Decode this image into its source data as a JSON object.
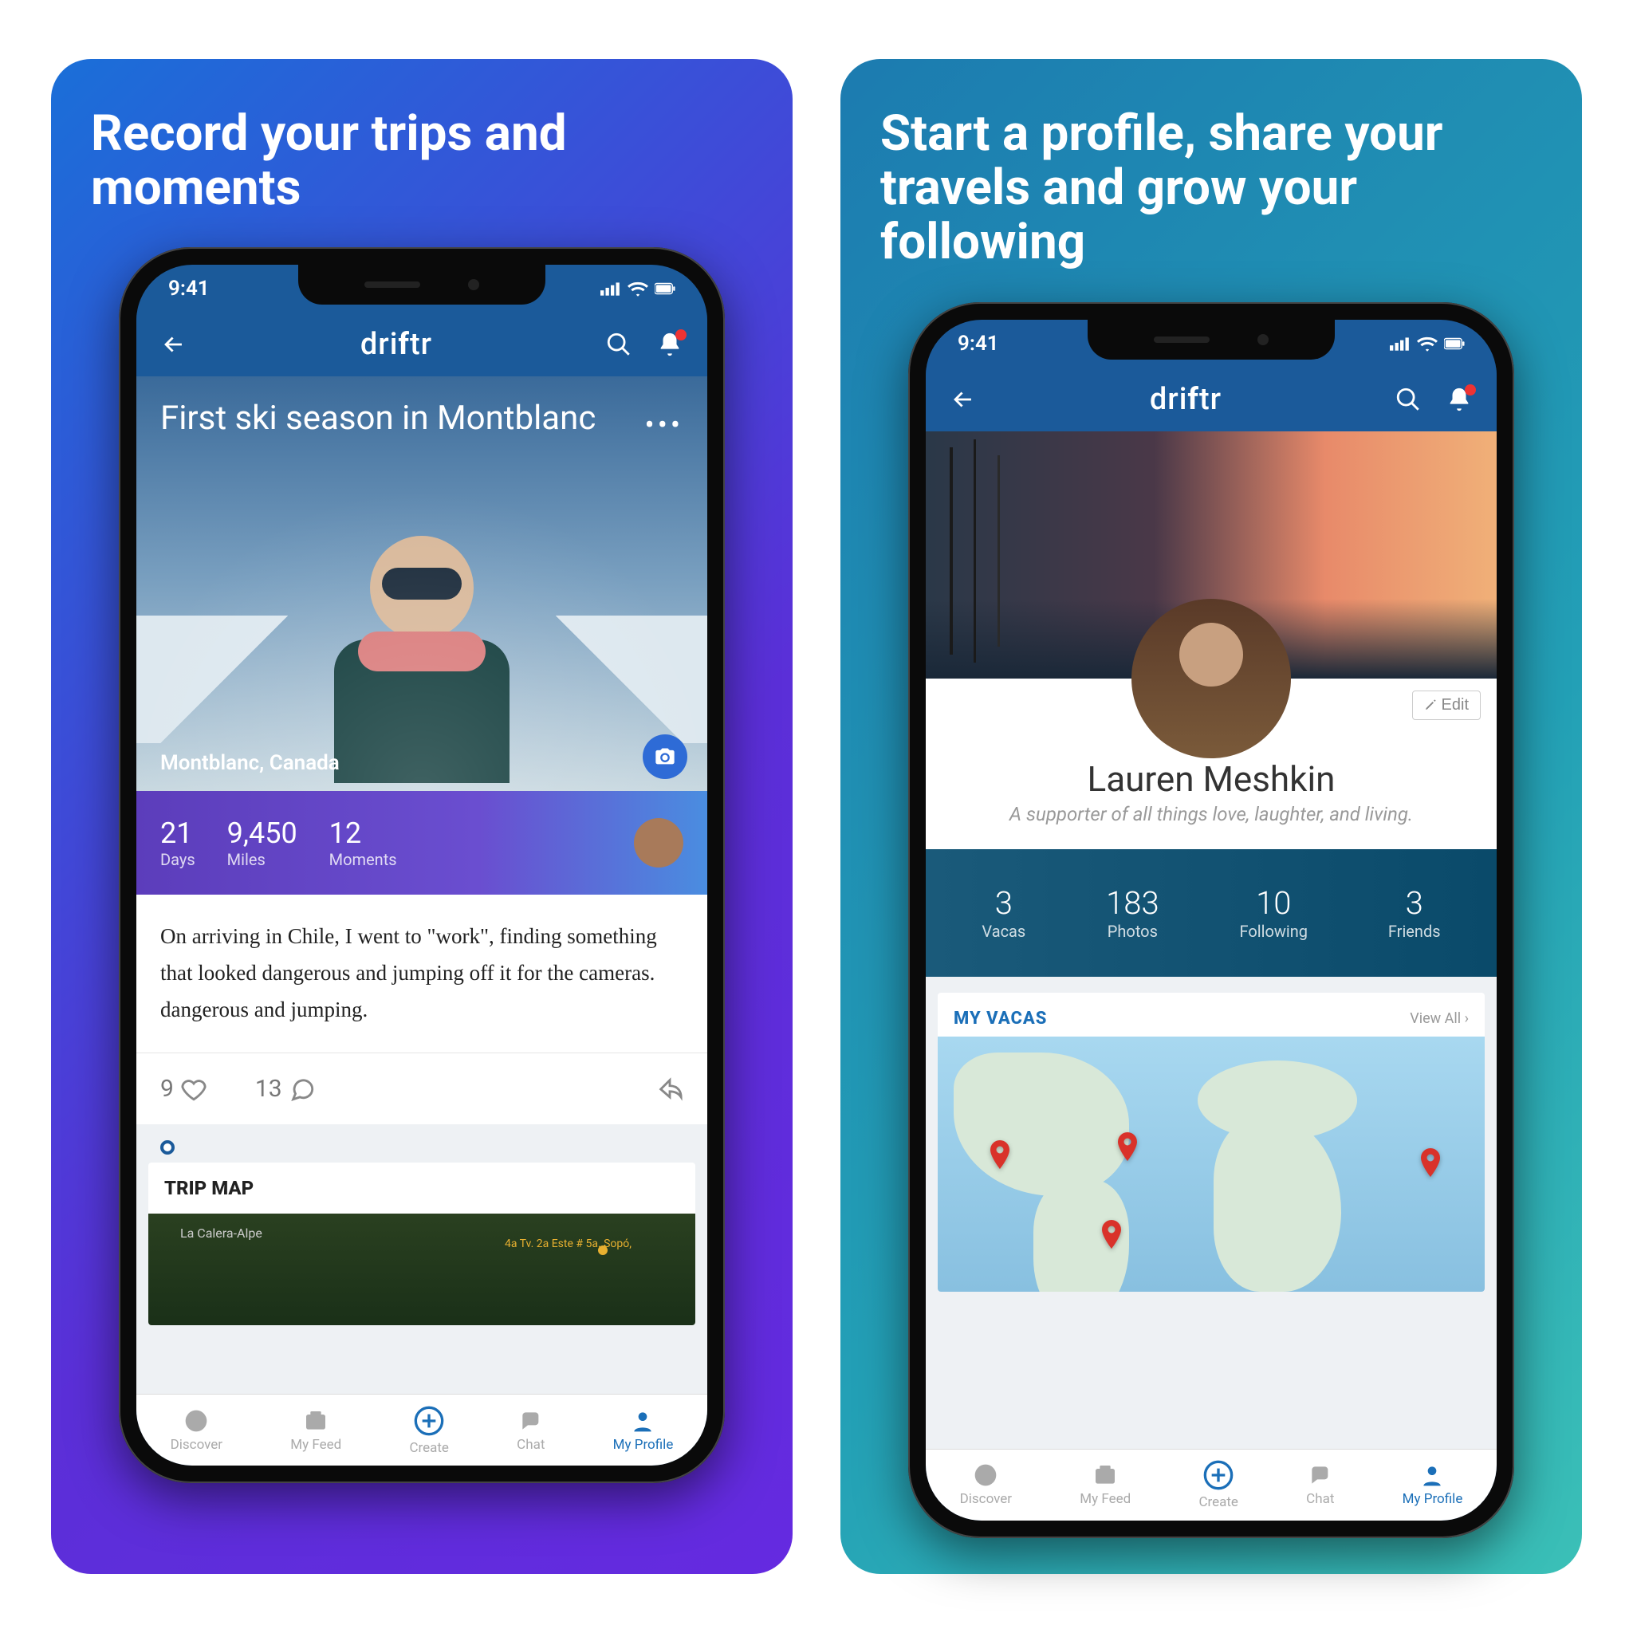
{
  "app": {
    "brand": "driftr",
    "statusTime": "9:41"
  },
  "nav": {
    "tabs": [
      {
        "label": "Discover"
      },
      {
        "label": "My Feed"
      },
      {
        "label": "Create"
      },
      {
        "label": "Chat"
      },
      {
        "label": "My Profile"
      }
    ]
  },
  "left": {
    "tagline": "Record your trips and moments",
    "trip": {
      "title": "First ski season in Montblanc",
      "location": "Montblanc, Canada",
      "stats": [
        {
          "num": "21",
          "lbl": "Days"
        },
        {
          "num": "9,450",
          "lbl": "Miles"
        },
        {
          "num": "12",
          "lbl": "Moments"
        }
      ],
      "body": "On arriving in Chile, I went to \"work\", finding something that looked dangerous and jumping off it for the cameras. dangerous and jumping.",
      "likes": "9",
      "comments": "13",
      "mapTitle": "TRIP MAP",
      "mapLabel1": "La Calera-Alpe",
      "mapLabel2": "4a Tv. 2a Este #\n5a. Sopó,"
    }
  },
  "right": {
    "tagline": "Start a profile, share your travels and grow your following",
    "editLabel": "Edit",
    "profile": {
      "name": "Lauren Meshkin",
      "bio": "A supporter of all things love, laughter, and living.",
      "stats": [
        {
          "n": "3",
          "l": "Vacas"
        },
        {
          "n": "183",
          "l": "Photos"
        },
        {
          "n": "10",
          "l": "Following"
        },
        {
          "n": "3",
          "l": "Friends"
        }
      ]
    },
    "vacas": {
      "title": "MY VACAS",
      "viewAll": "View All ›"
    }
  }
}
